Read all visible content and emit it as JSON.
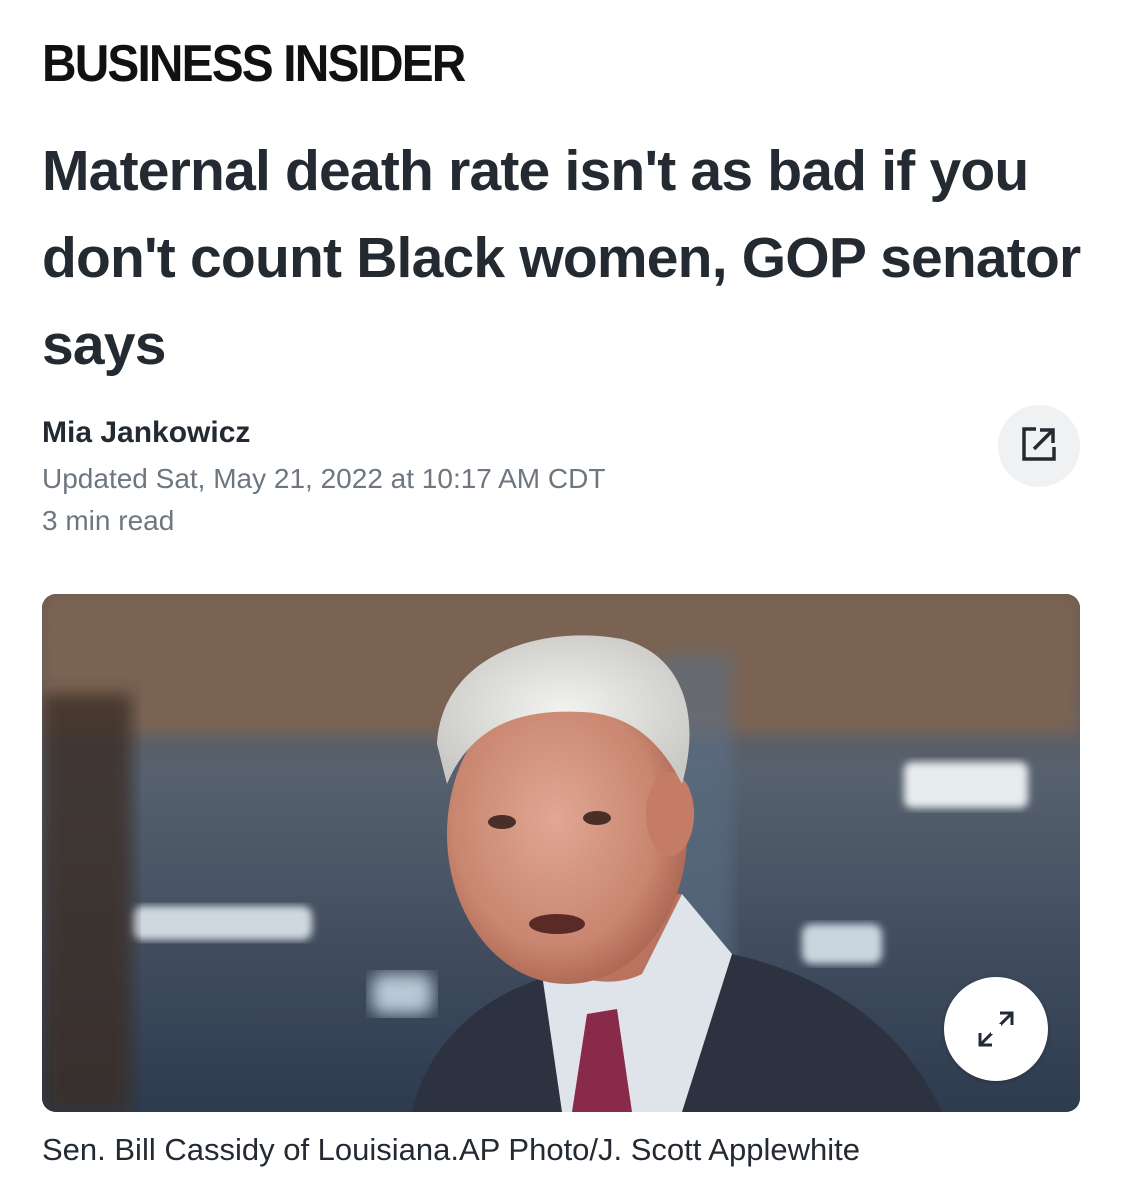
{
  "brand": {
    "name": "BUSINESS INSIDER"
  },
  "article": {
    "headline": "Maternal death rate isn't as bad if you don't count Black women, GOP senator says",
    "author": "Mia Jankowicz",
    "updated": "Updated Sat, May 21, 2022 at 10:17 AM CDT",
    "read_time": "3 min read"
  },
  "share": {
    "icon": "share-external-icon"
  },
  "photo": {
    "expand_icon": "expand-arrows-icon",
    "caption": "Sen. Bill Cassidy of Louisiana.AP Photo/J. Scott Applewhite"
  },
  "colors": {
    "text": "#232a31",
    "muted": "#6e7780",
    "brand": "#111111",
    "button_bg": "#f0f1f2"
  }
}
